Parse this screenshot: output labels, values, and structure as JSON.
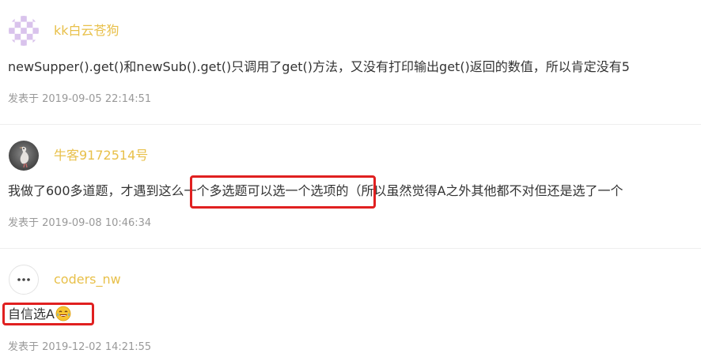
{
  "comments": [
    {
      "username": "kk白云苍狗",
      "content": "newSupper().get()和newSub().get()只调用了get()方法，又没有打印输出get()返回的数值，所以肯定没有5",
      "timestamp": "发表于 2019-09-05 22:14:51"
    },
    {
      "username": "牛客9172514号",
      "content": "我做了600多道题，才遇到这么一个多选题可以选一个选项的（所以虽然觉得A之外其他都不对但还是选了一个",
      "timestamp": "发表于 2019-09-08 10:46:34"
    },
    {
      "username": "coders_nw",
      "content": "自信选A",
      "timestamp": "发表于 2019-12-02 14:21:55"
    }
  ],
  "icons": {
    "avatar_1": "checkerboard-avatar-icon",
    "avatar_2": "bird-avatar-icon",
    "avatar_3": "more-dots-icon",
    "emoji": "laughing-tears-emoji-icon"
  },
  "colors": {
    "username": "#e8c04a",
    "text": "#333333",
    "timestamp": "#999999",
    "highlight": "#e02020",
    "divider": "#eeeeee",
    "avatar_purple": "#d9c3ec"
  }
}
